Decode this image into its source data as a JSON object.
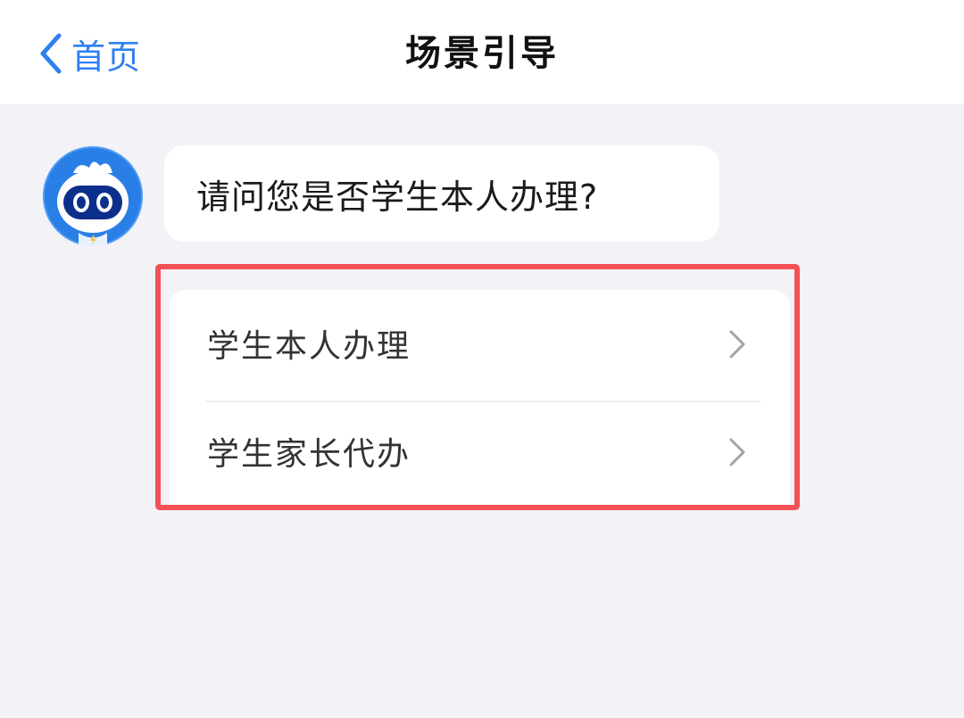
{
  "navbar": {
    "back_label": "首页",
    "title": "场景引导"
  },
  "chat": {
    "question": "请问您是否学生本人办理?",
    "avatar_icon": "robot-avatar-icon"
  },
  "options": [
    {
      "label": "学生本人办理",
      "icon": "chevron-right-icon"
    },
    {
      "label": "学生家长代办",
      "icon": "chevron-right-icon"
    }
  ],
  "colors": {
    "accent": "#2f7ff0",
    "highlight_border": "#f45157",
    "background": "#f2f2f7"
  }
}
